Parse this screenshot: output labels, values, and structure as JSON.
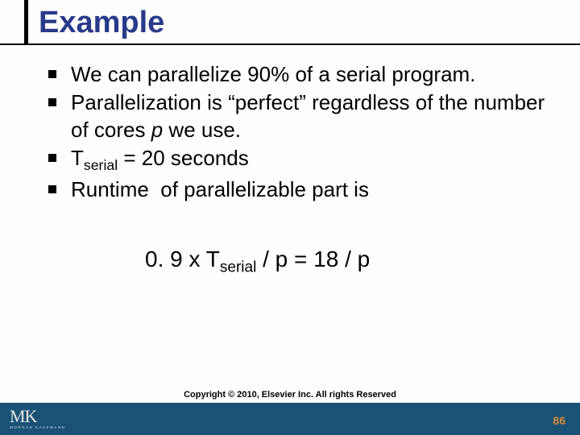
{
  "title": "Example",
  "bullets": [
    {
      "html": "We can parallelize 90% of a serial program."
    },
    {
      "html": "Parallelization is “perfect” regardless of the number of cores <span class=\"ital\">p</span> we use."
    },
    {
      "html": "T<span class=\"sub\">serial</span> = 20 seconds"
    },
    {
      "html": "Runtime&nbsp; of parallelizable part is"
    }
  ],
  "equation": "0. 9 x T<span class=\"sub\">serial</span> / p  = 18 / p",
  "logo": {
    "main": "MK",
    "sub": "MORGAN KAUFMANN"
  },
  "copyright": "Copyright © 2010, Elsevier Inc. All rights Reserved",
  "page": "86"
}
